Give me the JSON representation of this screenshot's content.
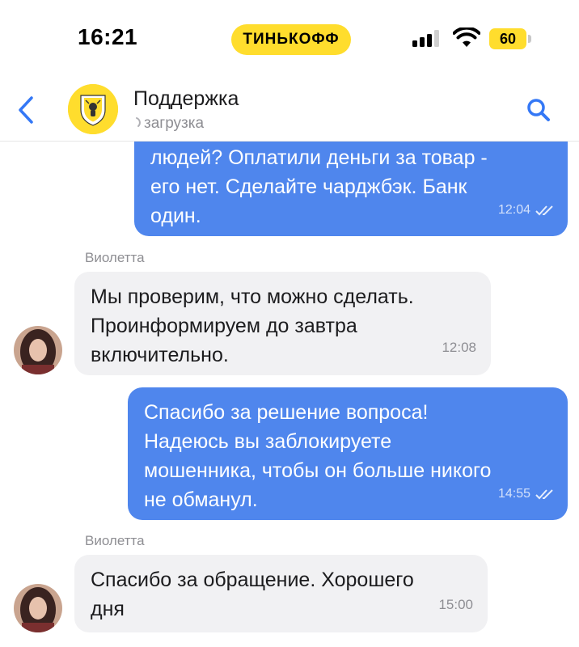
{
  "status_bar": {
    "time": "16:21",
    "carrier": "ТИНЬКОФФ",
    "battery": "60",
    "carrier_color": "#ffdd2d"
  },
  "header": {
    "title": "Поддержка",
    "subtitle": "загрузка",
    "back_icon": "chevron-left-icon",
    "search_icon": "search-icon",
    "accent_color": "#3478f6"
  },
  "messages": [
    {
      "direction": "outgoing",
      "text": "людей? Оплатили деньги за товар -\nего нет. Сделайте чарджбэк. Банк\nодин.",
      "time": "12:04",
      "status": "read"
    },
    {
      "direction": "incoming",
      "sender": "Виолетта",
      "text": "Мы проверим, что можно сделать.\nПроинформируем до завтра\nвключительно.",
      "time": "12:08"
    },
    {
      "direction": "outgoing",
      "text": "Спасибо за решение вопроса!\nНадеюсь вы заблокируете\nмошенника, чтобы он больше никого\nне обманул.",
      "time": "14:55",
      "status": "read"
    },
    {
      "direction": "incoming",
      "sender": "Виолетта",
      "text": "Спасибо за обращение. Хорошего\nдня",
      "time": "15:00"
    }
  ],
  "colors": {
    "outgoing_bubble": "#4f86ed",
    "incoming_bubble": "#f1f1f3"
  }
}
